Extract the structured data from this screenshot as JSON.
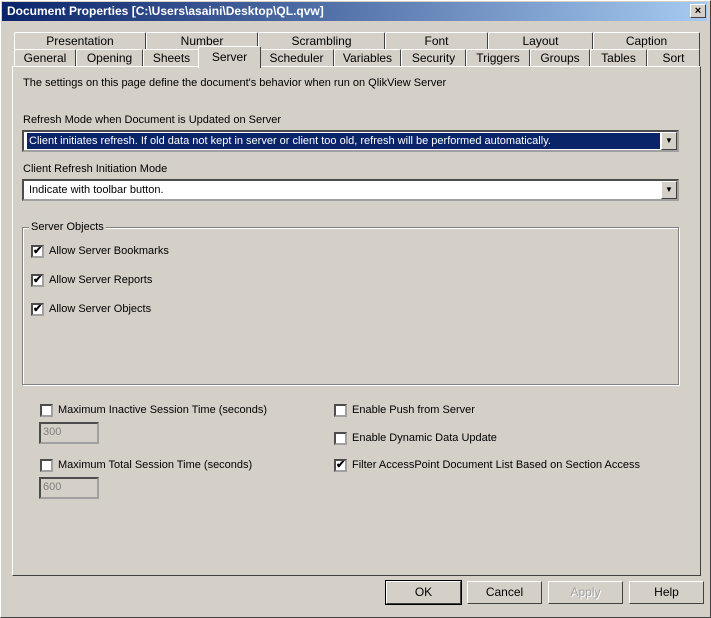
{
  "window": {
    "title": "Document Properties [C:\\Users\\asaini\\Desktop\\QL.qvw]",
    "close": "×"
  },
  "tabs_row1": [
    "Presentation",
    "Number",
    "Scrambling",
    "Font",
    "Layout",
    "Caption"
  ],
  "tabs_row2": [
    "General",
    "Opening",
    "Sheets",
    "Server",
    "Scheduler",
    "Variables",
    "Security",
    "Triggers",
    "Groups",
    "Tables",
    "Sort"
  ],
  "selected_tab": "Server",
  "description": "The settings on this page define the document's behavior when run on QlikView Server",
  "refresh_mode": {
    "label": "Refresh Mode when Document is Updated on Server",
    "value": "Client initiates refresh. If old data not kept in server or client too old, refresh will be performed automatically."
  },
  "client_refresh": {
    "label": "Client Refresh Initiation Mode",
    "value": "Indicate with toolbar button."
  },
  "server_objects": {
    "title": "Server Objects",
    "items": [
      {
        "label": "Allow Server Bookmarks",
        "checked": true
      },
      {
        "label": "Allow Server Reports",
        "checked": true
      },
      {
        "label": "Allow Server Objects",
        "checked": true
      }
    ]
  },
  "session": {
    "inactive": {
      "label": "Maximum Inactive Session Time (seconds)",
      "checked": false,
      "value": "300"
    },
    "total": {
      "label": "Maximum Total Session Time (seconds)",
      "checked": false,
      "value": "600"
    }
  },
  "options": [
    {
      "label": "Enable Push from Server",
      "checked": false
    },
    {
      "label": "Enable Dynamic Data Update",
      "checked": false
    },
    {
      "label": "Filter AccessPoint Document List Based on Section Access",
      "checked": true
    }
  ],
  "buttons": {
    "ok": "OK",
    "cancel": "Cancel",
    "apply": "Apply",
    "help": "Help"
  },
  "check_glyph": "✔",
  "arrow_glyph": "▼"
}
